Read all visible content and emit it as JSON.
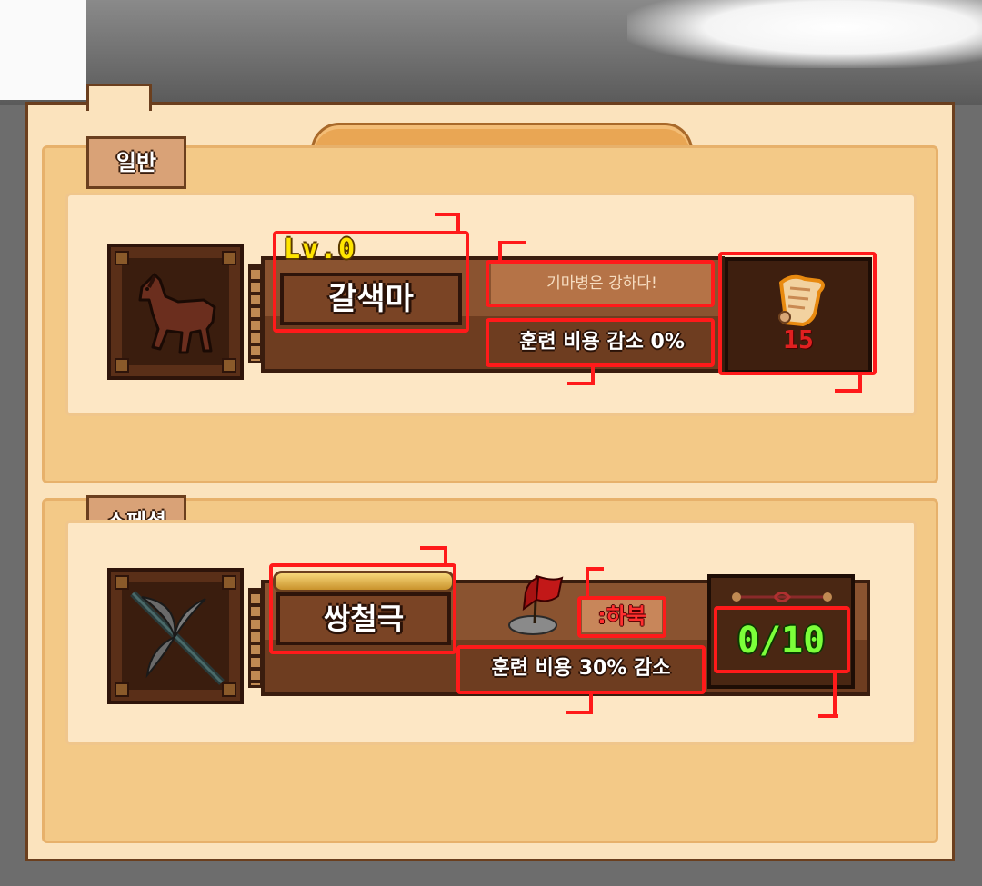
{
  "sections": {
    "general": {
      "tab_label": "일반",
      "unit": {
        "level": "Lv.0",
        "name": "갈색마",
        "icon": "horse-icon",
        "description": "기마병은 강하다!",
        "effect": "훈련 비용 감소 0%",
        "item_icon": "scroll-icon",
        "item_count": "15"
      }
    },
    "special": {
      "tab_label": "스페셜",
      "unit": {
        "name": "쌍철극",
        "icon": "double-halberd-icon",
        "requirement_icon": "red-flag-icon",
        "requirement": ":하북",
        "effect": "훈련 비용 30% 감소",
        "counter": "0/10"
      }
    }
  },
  "colors": {
    "highlight": "#ff1a1a",
    "level_text": "#ffe500",
    "counter_text": "#7cff3a",
    "panel_bg": "#fbe3bd"
  }
}
